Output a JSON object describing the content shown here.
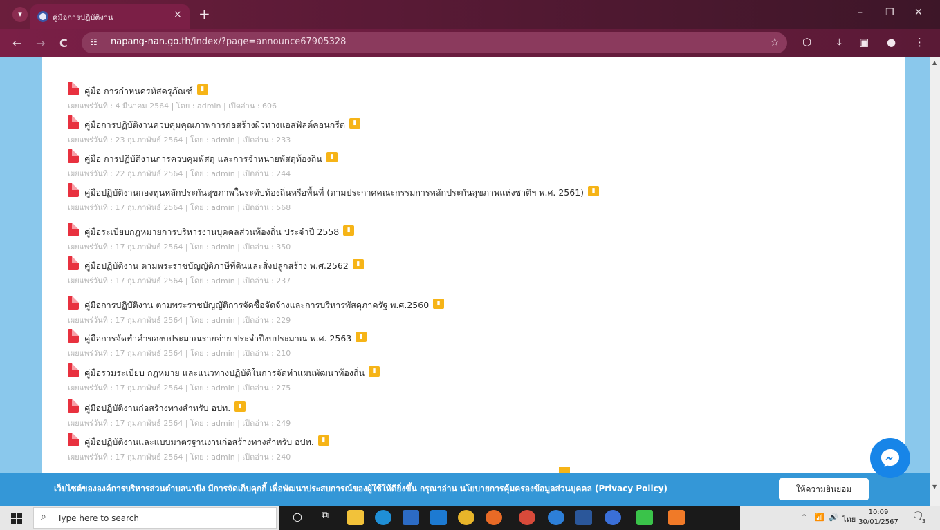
{
  "browser": {
    "tab_title": "คู่มือการปฏิบัติงาน",
    "tab_close": "×",
    "new_tab": "+",
    "url_host": "napang-nan.go.th",
    "url_path": "/index/?page=announce67905328",
    "window_controls": {
      "minimize": "–",
      "restore": "❐",
      "close": "✕"
    },
    "nav": {
      "back": "←",
      "forward": "→",
      "reload": "C"
    }
  },
  "items": [
    {
      "title": "คู่มือ การกำหนดรหัสครุภัณฑ์",
      "meta": "เผยแพร่วันที่ : 4 มีนาคม 2564 | โดย : admin | เปิดอ่าน : 606"
    },
    {
      "title": "คู่มือการปฏิบัติงานควบคุมคุณภาพการก่อสร้างผิวทางแอสฟัลต์คอนกรีต",
      "meta": "เผยแพร่วันที่ : 23 กุมภาพันธ์ 2564 | โดย : admin | เปิดอ่าน : 233"
    },
    {
      "title": "คู่มือ การปฏิบัติงานการควบคุมพัสดุ และการจำหน่ายพัสดุท้องถิ่น",
      "meta": "เผยแพร่วันที่ : 22 กุมภาพันธ์ 2564 | โดย : admin | เปิดอ่าน : 244"
    },
    {
      "title": "คู่มือปฏิบัติงานกองทุนหลักประกันสุขภาพในระดับท้องถิ่นหรือพื้นที่ (ตามประกาศคณะกรรมการหลักประกันสุขภาพแห่งชาติฯ พ.ศ. 2561)",
      "meta": "เผยแพร่วันที่ : 17 กุมภาพันธ์ 2564 | โดย : admin | เปิดอ่าน : 568"
    },
    {
      "title": "คู่มือระเบียบกฎหมายการบริหารงานบุคคลส่วนท้องถิ่น ประจำปี 2558",
      "meta": "เผยแพร่วันที่ : 17 กุมภาพันธ์ 2564 | โดย : admin | เปิดอ่าน : 350"
    },
    {
      "title": "คู่มือปฏิบัติงาน ตามพระราชบัญญัติภาษีที่ดินและสิ่งปลูกสร้าง พ.ศ.2562",
      "meta": "เผยแพร่วันที่ : 17 กุมภาพันธ์ 2564 | โดย : admin | เปิดอ่าน : 237"
    },
    {
      "title": "คู่มือการปฏิบัติงาน ตามพระราชบัญญัติการจัดซื้อจัดจ้างและการบริหารพัสดุภาครัฐ พ.ศ.2560",
      "meta": "เผยแพร่วันที่ : 17 กุมภาพันธ์ 2564 | โดย : admin | เปิดอ่าน : 229"
    },
    {
      "title": "คู่มือการจัดทำคำของบประมาณรายจ่าย ประจำปีงบประมาณ พ.ศ. 2563",
      "meta": "เผยแพร่วันที่ : 17 กุมภาพันธ์ 2564 | โดย : admin | เปิดอ่าน : 210"
    },
    {
      "title": "คู่มือรวมระเบียบ กฎหมาย และแนวทางปฏิบัติในการจัดทำแผนพัฒนาท้องถิ่น",
      "meta": "เผยแพร่วันที่ : 17 กุมภาพันธ์ 2564 | โดย : admin | เปิดอ่าน : 275"
    },
    {
      "title": "คู่มือปฏิบัติงานก่อสร้างทางสำหรับ อปท.",
      "meta": "เผยแพร่วันที่ : 17 กุมภาพันธ์ 2564 | โดย : admin | เปิดอ่าน : 249"
    },
    {
      "title": "คู่มือปฏิบัติงานและแบบมาตรฐานงานก่อสร้างทางสำหรับ อปท.",
      "meta": "เผยแพร่วันที่ : 17 กุมภาพันธ์ 2564 | โดย : admin | เปิดอ่าน : 240"
    }
  ],
  "cookie": {
    "text": "เว็บไซต์ขององค์การบริหารส่วนตำบลนาปัง มีการจัดเก็บคุกกี้ เพื่อพัฒนาประสบการณ์ของผู้ใช้ให้ดียิ่งขึ้น กรุณาอ่าน นโยบายการคุ้มครองข้อมูลส่วนบุคคล (Privacy Policy)",
    "accept": "ให้ความยินยอม"
  },
  "taskbar": {
    "search_placeholder": "Type here to search",
    "language": "ไทย",
    "time": "10:09",
    "date": "30/01/2567",
    "notifications": "3"
  },
  "colors": {
    "browser_frame": "#7a1f46",
    "cookie_banner": "#3497d7",
    "page_side": "#8ac8ec",
    "pdf_icon": "#e8313f",
    "stats_badge": "#f6b417",
    "messenger": "#1785e8"
  }
}
